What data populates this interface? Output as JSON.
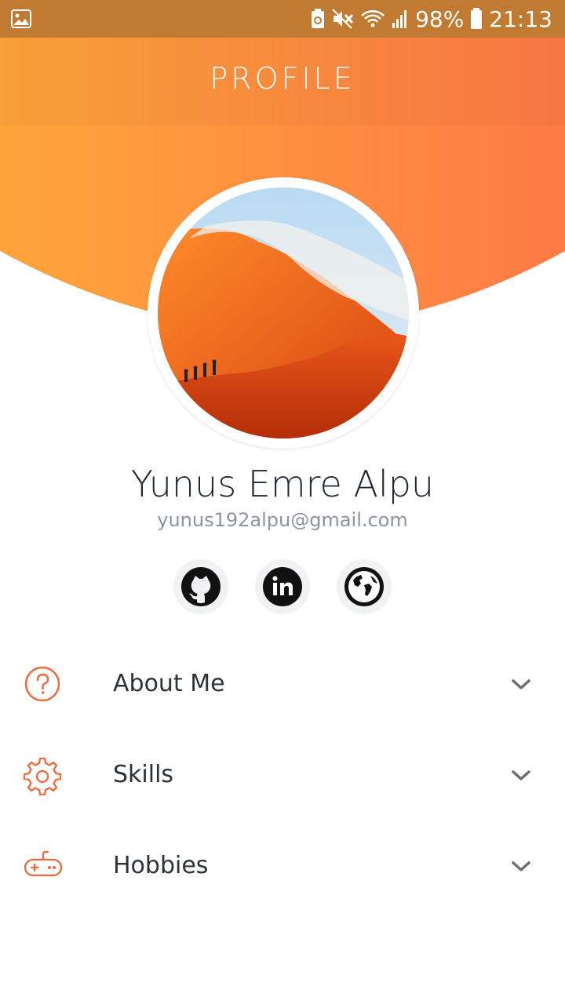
{
  "status_bar": {
    "battery": "98%",
    "time": "21:13"
  },
  "header": {
    "title": "PROFILE"
  },
  "profile": {
    "name": "Yunus Emre Alpu",
    "email": "yunus192alpu@gmail.com"
  },
  "socials": [
    {
      "icon": "github-icon"
    },
    {
      "icon": "linkedin-icon"
    },
    {
      "icon": "globe-icon"
    }
  ],
  "menu": {
    "items": [
      {
        "label": "About Me",
        "icon": "question-circle-icon"
      },
      {
        "label": "Skills",
        "icon": "gear-icon"
      },
      {
        "label": "Hobbies",
        "icon": "gamepad-icon"
      }
    ]
  },
  "colors": {
    "status_bar": "#c17a32",
    "header_start": "#ffa53a",
    "header_end": "#ff7a45",
    "accent": "#f06a3c"
  }
}
